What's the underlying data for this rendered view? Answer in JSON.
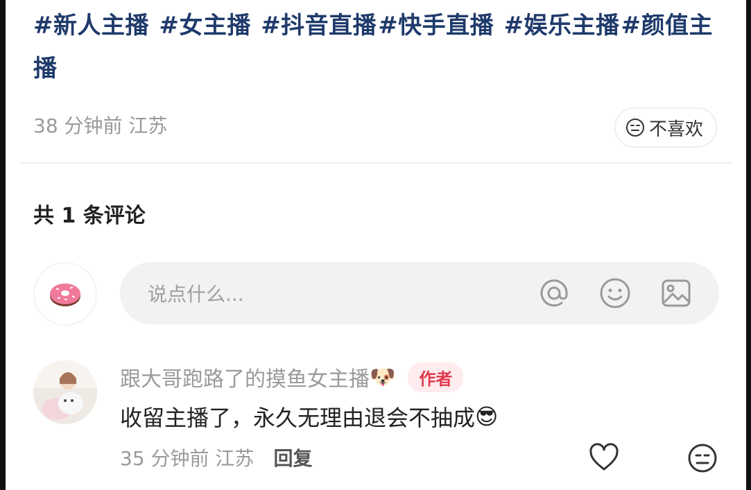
{
  "post": {
    "tags": [
      "#新人主播",
      "#女主播",
      "#抖音直播",
      "#快手直播",
      "#娱乐主播",
      "#颜值主播"
    ],
    "time_location": "38 分钟前 江苏",
    "dislike_label": "不喜欢"
  },
  "comments": {
    "count_label": "共 1 条评论",
    "input_placeholder": "说点什么...",
    "input_icons": [
      "at-icon",
      "emoji-icon",
      "image-icon"
    ],
    "items": [
      {
        "username": "跟大哥跑路了的摸鱼女主播",
        "user_emoji": "🐶",
        "badge": "作者",
        "text": "收留主播了，永久无理由退会不抽成",
        "text_emoji": "😎",
        "time_location": "35 分钟前 江苏",
        "reply_label": "回复"
      }
    ]
  },
  "colors": {
    "tag_blue": "#1f3a6b",
    "badge_red": "#e03a4e",
    "badge_bg": "#ffecee",
    "muted_gray": "#9a9a9a"
  }
}
